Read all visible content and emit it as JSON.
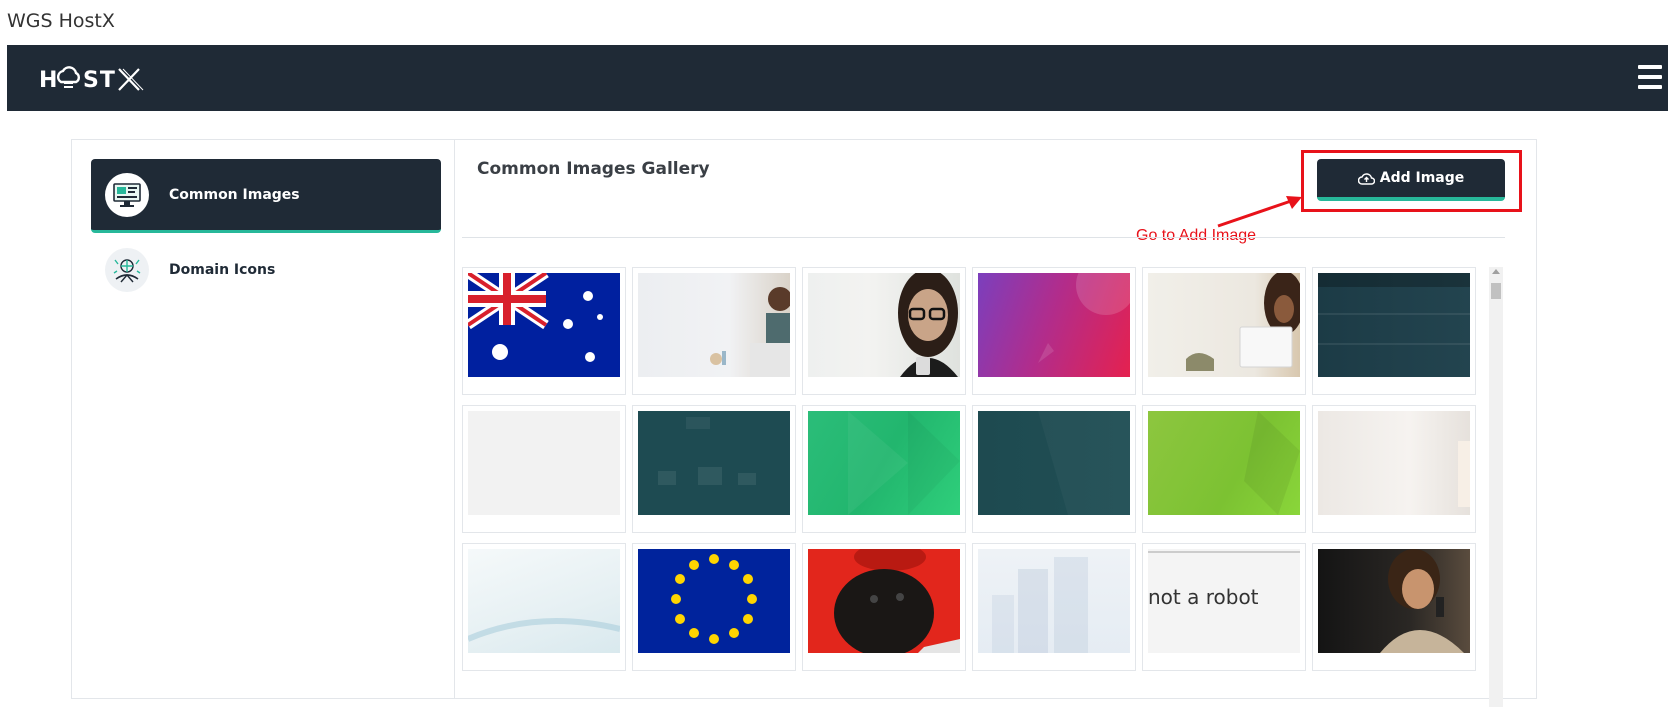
{
  "app": {
    "title": "WGS HostX",
    "brand": "HOSTX"
  },
  "sidebar": {
    "items": [
      {
        "label": "Common Images",
        "icon": "monitor-gallery-icon",
        "active": true
      },
      {
        "label": "Domain Icons",
        "icon": "globe-network-icon",
        "active": false
      }
    ]
  },
  "main": {
    "title": "Common Images Gallery",
    "add_button_label": "Add Image",
    "annotation": "Go to Add Image"
  },
  "gallery": {
    "images": [
      "australia-flag",
      "woman-laptop-celebrating",
      "woman-glasses-phone",
      "purple-gradient-banner",
      "woman-laptop-desk",
      "server-rack",
      "light-gray-blank",
      "teal-workspace",
      "green-geometric",
      "dark-teal-geometric",
      "lime-geometric",
      "blurred-light-room",
      "light-wave",
      "eu-flag",
      "pug-red-beret",
      "city-buildings-light",
      "captcha-not-a-robot",
      "woman-on-phone"
    ],
    "captcha_text": "not a robot"
  },
  "colors": {
    "navy": "#1f2a36",
    "accent": "#27b89a",
    "highlight": "#e8121a"
  }
}
